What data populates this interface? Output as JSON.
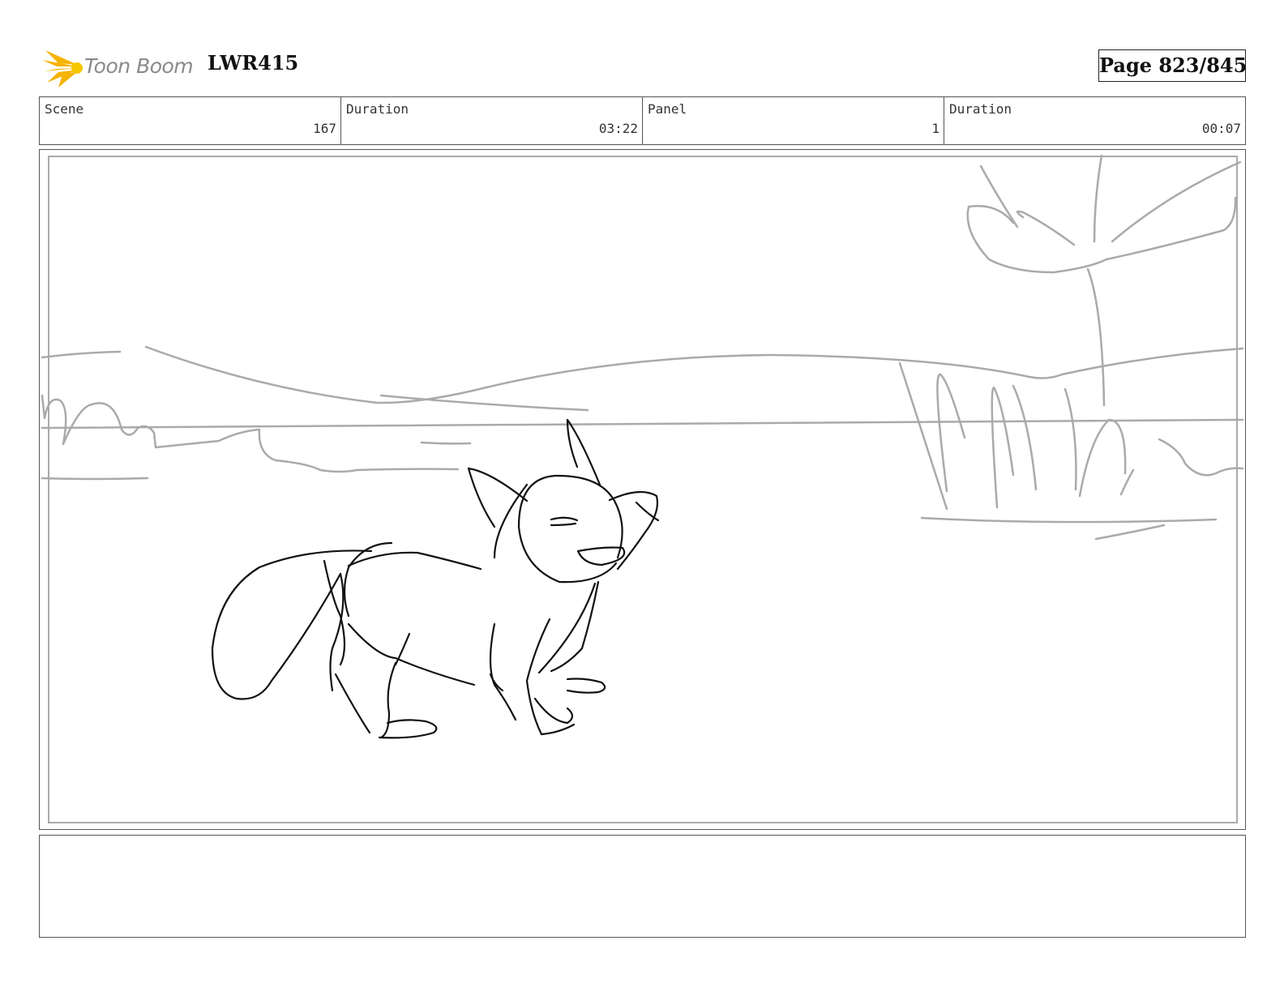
{
  "header": {
    "logo_text": "Toon Boom",
    "project_code": "LWR415",
    "page_label": "Page 823/845"
  },
  "info": {
    "scene_label": "Scene",
    "scene_value": "167",
    "scene_duration_label": "Duration",
    "scene_duration_value": "03:22",
    "panel_label": "Panel",
    "panel_value": "1",
    "panel_duration_label": "Duration",
    "panel_duration_value": "00:07"
  },
  "panel": {
    "image": "storyboard-sketch",
    "colors": {
      "sketch": "#111111",
      "background_sketch": "#aaaaaa",
      "frame": "#555555"
    }
  },
  "notes": {
    "text": ""
  }
}
